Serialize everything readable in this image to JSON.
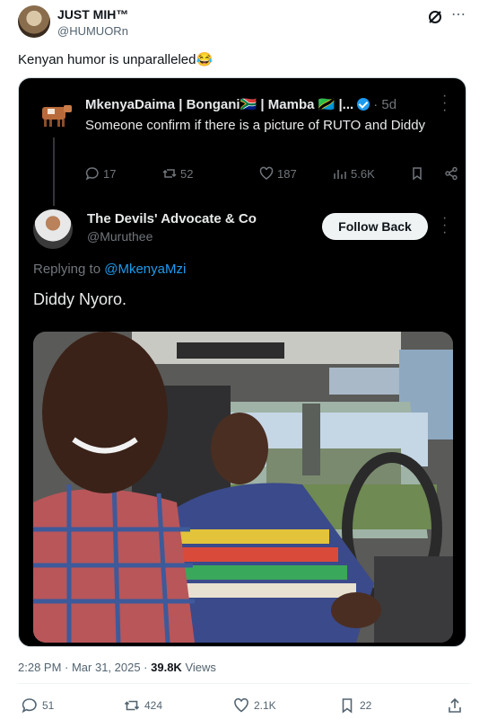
{
  "author": {
    "name": "JUST MIH™",
    "handle": "@HUMUORn"
  },
  "tweet": {
    "text": "Kenyan humor is unparalleled😂",
    "timestamp": "2:28 PM · Mar 31, 2025 · ",
    "views": "39.8K",
    "views_label": " Views"
  },
  "quoted": {
    "name": "MkenyaDaima | Bongani🇿🇦 | Mamba 🇹🇿 |...",
    "time": "5d",
    "text": "Someone confirm if there is a picture of RUTO and Diddy",
    "replies": "17",
    "reposts": "52",
    "likes": "187",
    "views": "5.6K"
  },
  "reply": {
    "name": "The Devils' Advocate & Co",
    "handle": "@Muruthee",
    "follow_label": "Follow Back",
    "replying_prefix": "Replying to ",
    "replying_to": "@MkenyaMzi",
    "text": "Diddy Nyoro."
  },
  "actions": {
    "replies": "51",
    "reposts": "424",
    "likes": "2.1K",
    "bookmarks": "22"
  },
  "colors": {
    "accent": "#1d9bf0",
    "card_bg": "#000000",
    "verified": "#1d9bf0"
  }
}
